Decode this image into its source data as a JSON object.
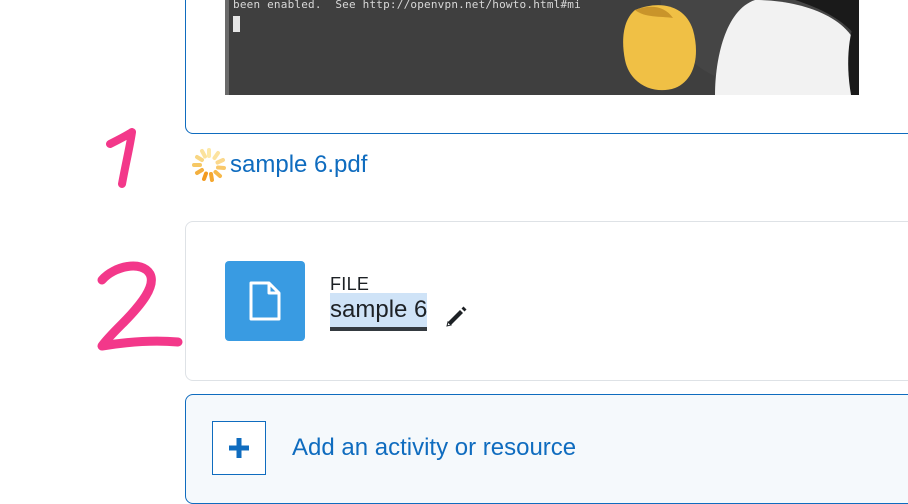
{
  "terminal": {
    "line1": "been enabled.  See http://openvpn.net/howto.html#mi"
  },
  "annotations": {
    "one": "1",
    "two": "2"
  },
  "pdf_resource": {
    "name": "sample 6.pdf"
  },
  "file_activity": {
    "type_label": "FILE",
    "name": "sample 6"
  },
  "add_activity": {
    "label": "Add an activity or resource"
  },
  "colors": {
    "link": "#0f6cbf",
    "file_icon_bg": "#399be2",
    "annotation": "#f3388a",
    "selection": "#cfe3f7"
  },
  "icons": {
    "loading": "spinner-icon",
    "file": "document-icon",
    "edit": "pencil-icon",
    "add": "plus-icon"
  }
}
